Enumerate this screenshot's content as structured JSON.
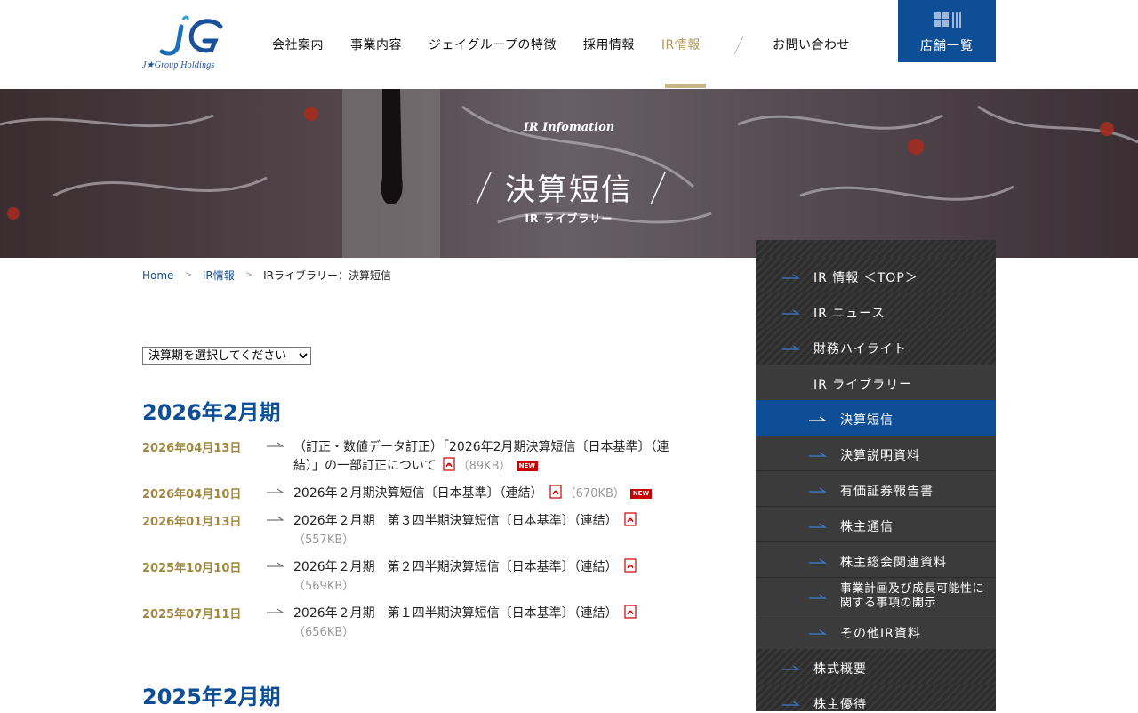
{
  "header": {
    "logo_text": "J★Group Holdings",
    "nav": [
      "会社案内",
      "事業内容",
      "ジェイグループの特徴",
      "採用情報",
      "IR情報"
    ],
    "nav_active": "IR情報",
    "contact": "お問い合わせ",
    "store_button": "店舗一覧",
    "accent": "#0e4e97",
    "gold": "#b39a5b"
  },
  "hero": {
    "subtitle": "IR Infomation",
    "title": "決算短信",
    "caption": "IR ライブラリー"
  },
  "breadcrumb": {
    "home": "Home",
    "sep": ">",
    "ir": "IR情報",
    "current": "IRライブラリー：決算短信"
  },
  "select": {
    "value": "決算期を選択してください"
  },
  "sections": [
    {
      "heading": "2026年2月期",
      "rows": [
        {
          "date": "2026年04月13日",
          "title": "（訂正・数値データ訂正）「2026年2月期決算短信〔日本基準〕（連結）」の一部訂正について",
          "size": "（89KB）",
          "new": "NEW"
        },
        {
          "date": "2026年04月10日",
          "title": "2026年２月期決算短信〔日本基準〕（連結）",
          "size": "（670KB）",
          "new": "NEW"
        },
        {
          "date": "2026年01月13日",
          "title": "2026年２月期　第３四半期決算短信〔日本基準〕（連結）",
          "size": "（557KB）"
        },
        {
          "date": "2025年10月10日",
          "title": "2026年２月期　第２四半期決算短信〔日本基準〕（連結）",
          "size": "（569KB）"
        },
        {
          "date": "2025年07月11日",
          "title": "2026年２月期　第１四半期決算短信〔日本基準〕（連結）",
          "size": "（656KB）"
        }
      ]
    },
    {
      "heading": "2025年2月期"
    }
  ],
  "sidebar": [
    "IR 情報 ＜TOP＞",
    "IR ニュース",
    "財務ハイライト",
    "IR ライブラリー",
    "決算短信",
    "決算説明資料",
    "有価証券報告書",
    "株主通信",
    "株主総会関連資料",
    "事業計画及び成長可能性に",
    "関する事項の開示",
    "その他IR資料",
    "株式概要",
    "株主優待"
  ]
}
